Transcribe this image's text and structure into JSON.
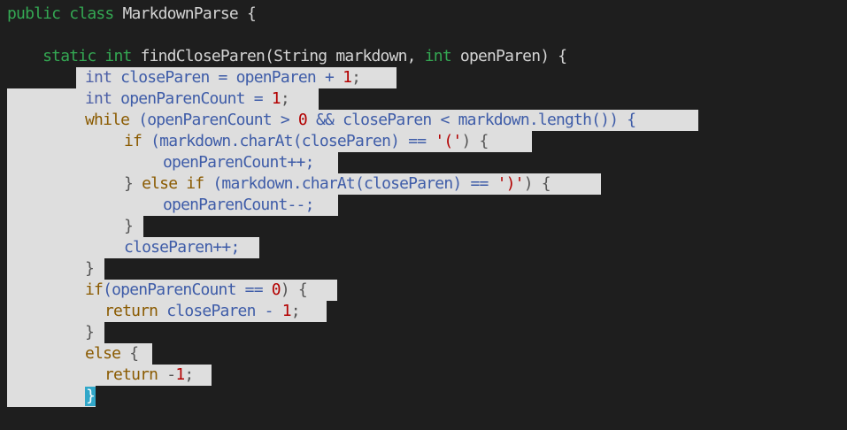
{
  "editor": {
    "lines": [
      {
        "tokens": [
          {
            "t": "public class ",
            "c": "k"
          },
          {
            "t": "MarkdownParse {",
            "c": "pl"
          }
        ]
      },
      {
        "tokens": []
      },
      {
        "tokens": [
          {
            "t": "    static int ",
            "c": "k"
          },
          {
            "t": "findCloseParen(String markdown, ",
            "c": "pl"
          },
          {
            "t": "int ",
            "c": "k"
          },
          {
            "t": "openParen) {",
            "c": "pl"
          }
        ]
      },
      {
        "tokens": [
          {
            "t": "int ",
            "c": "t"
          },
          {
            "t": "closeParen = openParen + ",
            "c": "v"
          },
          {
            "t": "1",
            "c": "n"
          },
          {
            "t": ";",
            "c": "p"
          }
        ]
      },
      {
        "tokens": [
          {
            "t": "int ",
            "c": "t"
          },
          {
            "t": "openParenCount = ",
            "c": "v"
          },
          {
            "t": "1",
            "c": "n"
          },
          {
            "t": ";",
            "c": "p"
          }
        ]
      },
      {
        "tokens": [
          {
            "t": "while ",
            "c": "k"
          },
          {
            "t": "(openParenCount > ",
            "c": "v"
          },
          {
            "t": "0",
            "c": "n"
          },
          {
            "t": " && closeParen < markdown.length()) {",
            "c": "v"
          }
        ]
      },
      {
        "tokens": [
          {
            "t": "if ",
            "c": "k"
          },
          {
            "t": "(markdown.charAt(closeParen) == ",
            "c": "v"
          },
          {
            "t": "'('",
            "c": "s"
          },
          {
            "t": ") {",
            "c": "p"
          }
        ]
      },
      {
        "tokens": [
          {
            "t": "openParenCount++;",
            "c": "v"
          }
        ]
      },
      {
        "tokens": [
          {
            "t": "} ",
            "c": "p"
          },
          {
            "t": "else if ",
            "c": "k"
          },
          {
            "t": "(markdown.charAt(closeParen) == ",
            "c": "v"
          },
          {
            "t": "')'",
            "c": "s"
          },
          {
            "t": ") {",
            "c": "p"
          }
        ]
      },
      {
        "tokens": [
          {
            "t": "openParenCount--;",
            "c": "v"
          }
        ]
      },
      {
        "tokens": [
          {
            "t": "}",
            "c": "p"
          }
        ]
      },
      {
        "tokens": [
          {
            "t": "closeParen++;",
            "c": "v"
          }
        ]
      },
      {
        "tokens": [
          {
            "t": "}",
            "c": "p"
          }
        ]
      },
      {
        "tokens": [
          {
            "t": "if",
            "c": "k"
          },
          {
            "t": "(openParenCount == ",
            "c": "v"
          },
          {
            "t": "0",
            "c": "n"
          },
          {
            "t": ") {",
            "c": "p"
          }
        ]
      },
      {
        "tokens": [
          {
            "t": "return ",
            "c": "k"
          },
          {
            "t": "closeParen - ",
            "c": "v"
          },
          {
            "t": "1",
            "c": "n"
          },
          {
            "t": ";",
            "c": "p"
          }
        ]
      },
      {
        "tokens": [
          {
            "t": "}",
            "c": "p"
          }
        ]
      },
      {
        "tokens": [
          {
            "t": "else ",
            "c": "k"
          },
          {
            "t": "{",
            "c": "p"
          }
        ]
      },
      {
        "tokens": [
          {
            "t": "return ",
            "c": "k"
          },
          {
            "t": "-",
            "c": "p"
          },
          {
            "t": "1",
            "c": "n"
          },
          {
            "t": ";",
            "c": "p"
          }
        ]
      },
      {
        "tokens": [
          {
            "t": "}",
            "c": "cursor"
          }
        ]
      }
    ]
  }
}
